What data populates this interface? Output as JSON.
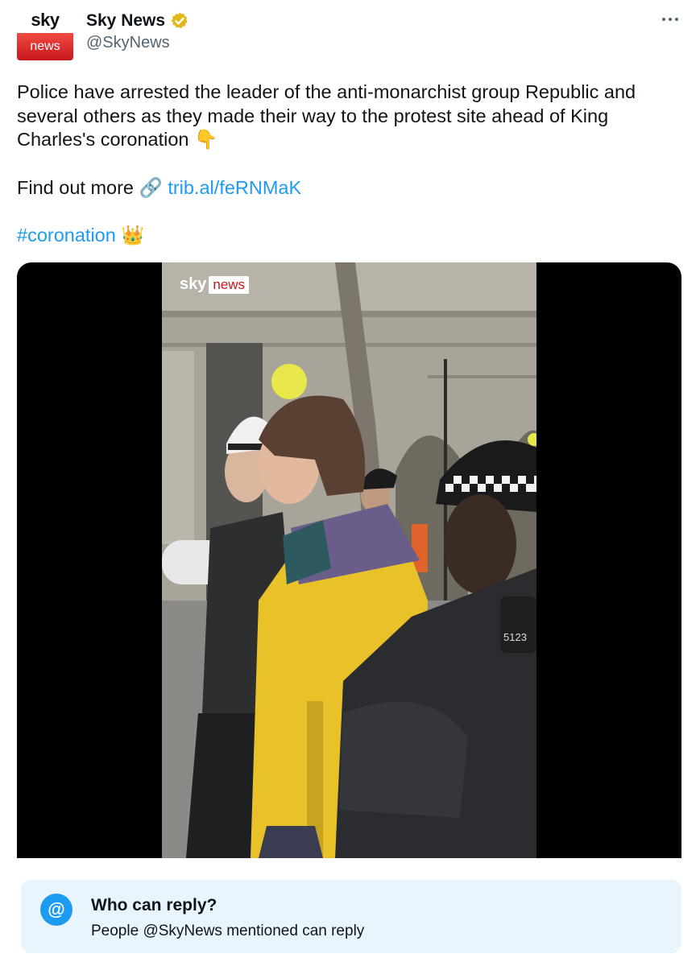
{
  "account": {
    "avatar_top": "sky",
    "avatar_bottom": "news",
    "display_name": "Sky News",
    "handle": "@SkyNews",
    "verified_icon": "verified-badge-icon",
    "more_icon": "more-options-icon"
  },
  "tweet": {
    "text": "Police have arrested the leader of the anti-monarchist group Republic and several others as they made their way to the protest site ahead of King Charles's coronation",
    "hand_emoji": "👇",
    "find_out_more": "Find out more",
    "link_icon": "🔗",
    "link_text": "trib.al/feRNMaK",
    "hashtag": "#coronation",
    "crown_emoji": "👑"
  },
  "media": {
    "watermark_sky": "sky",
    "watermark_news": "news"
  },
  "reply_restriction": {
    "icon": "@",
    "title": "Who can reply?",
    "subtitle": "People @SkyNews mentioned can reply"
  },
  "colors": {
    "link": "#1d9bf0",
    "handle": "#536471",
    "reply_bg": "#e8f5fd",
    "sky_red": "#c8161d"
  }
}
